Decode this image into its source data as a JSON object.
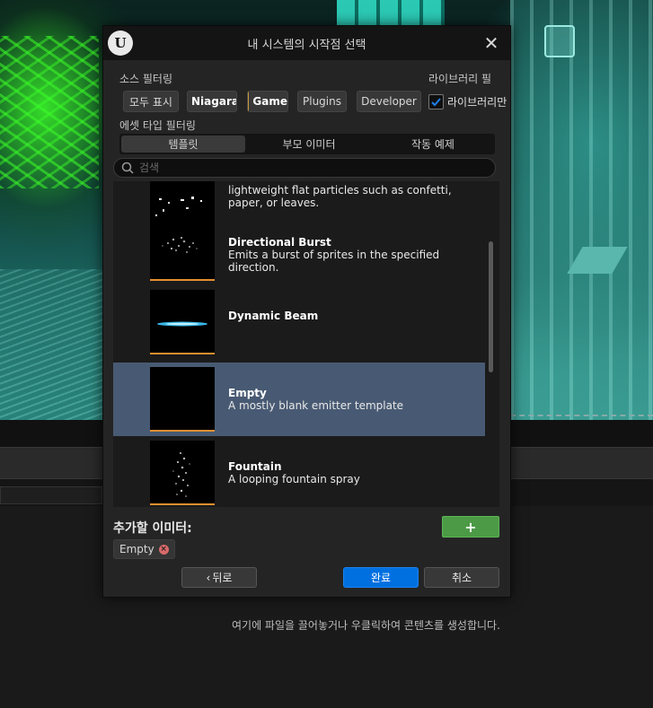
{
  "background": {
    "drop_hint": "여기에 파일을 끌어놓거나 우클릭하여 콘텐츠를 생성합니다."
  },
  "dialog": {
    "title": "내 시스템의 시작점 선택",
    "close_icon": "close-icon"
  },
  "source_filter": {
    "label": "소스 필터링",
    "chips": [
      {
        "label": "모두 표시",
        "color": ""
      },
      {
        "label": "Niagara",
        "color": "#c9c9c9"
      },
      {
        "label": "Game",
        "color": "#c99a3c"
      },
      {
        "label": "Plugins",
        "color": ""
      },
      {
        "label": "Developer",
        "color": ""
      }
    ]
  },
  "library_filter": {
    "label": "라이브러리 필",
    "checkbox_label": "라이브러리만",
    "checked": true
  },
  "asset_type_filter": {
    "label": "에셋 타입 필터링",
    "tabs": [
      "템플릿",
      "부모 이미터",
      "작동 예제"
    ],
    "active_tab": 0
  },
  "search": {
    "placeholder": "검색"
  },
  "emitters": [
    {
      "title": "",
      "description": "lightweight flat particles such as confetti, paper, or leaves.",
      "thumb": "confetti"
    },
    {
      "title": "Directional Burst",
      "description": "Emits a burst of sprites in the specified direction.",
      "thumb": "burst"
    },
    {
      "title": "Dynamic Beam",
      "description": "",
      "thumb": "beam"
    },
    {
      "title": "Empty",
      "description": "A mostly blank emitter template",
      "thumb": "empty",
      "selected": true
    },
    {
      "title": "Fountain",
      "description": "A looping fountain spray",
      "thumb": "fountain"
    }
  ],
  "add_section": {
    "label": "추가할 이미터:",
    "add_button": "+",
    "selected_tag": "Empty"
  },
  "buttons": {
    "back": "뒤로",
    "done": "완료",
    "cancel": "취소"
  },
  "colors": {
    "accent_green": "#4c9a46",
    "accent_blue": "#0070e0",
    "selection": "#485a73",
    "thumb_underline": "#e58e2f"
  }
}
